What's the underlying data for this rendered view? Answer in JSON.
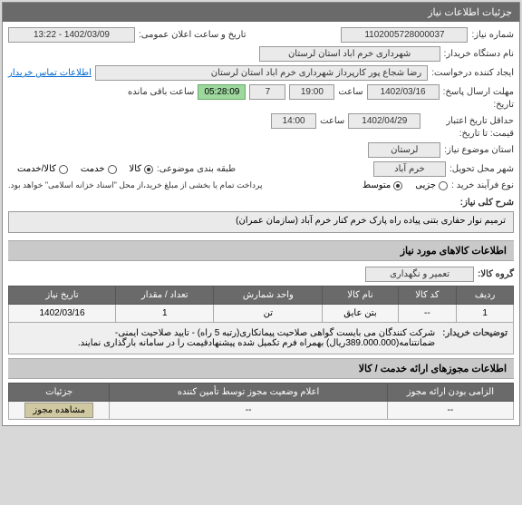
{
  "panel1_title": "جزئیات اطلاعات نیاز",
  "labels": {
    "need_no": "شماره نیاز:",
    "announce_date": "تاریخ و ساعت اعلان عمومی:",
    "buyer_org": "نام دستگاه خریدار:",
    "request_creator": "ایجاد کننده درخواست:",
    "contact": "اطلاعات تماس خریدار",
    "reply_deadline": "مهلت ارسال پاسخ:",
    "hour": "ساعت",
    "remain": "ساعت باقی مانده",
    "date": "تاریخ:",
    "min_credit": "حداقل تاریخ اعتبار",
    "price_until": "قیمت: تا تاریخ:",
    "subject_province": "استان موضوع نیاز:",
    "delivery_city": "شهر محل تحویل:",
    "category": "طبقه بندی موضوعی:",
    "goods": "کالا",
    "service": "خدمت",
    "goods_service": "کالا/خدمت",
    "purchase_type": "نوع فرآیند خرید :",
    "partial": "جزیی",
    "medium": "متوسط",
    "payment_note": "پرداخت تمام یا بخشی از مبلغ خرید،از محل \"اسناد خزانه اسلامی\" خواهد بود.",
    "need_desc_label": "شرح کلی نیاز:",
    "goods_group": "گروه کالا:",
    "buyer_notes_label": "توضیحات خریدار:"
  },
  "values": {
    "need_no": "1102005728000037",
    "announce_date": "1402/03/09 - 13:22",
    "buyer_org": "شهرداری خرم اباد استان لرستان",
    "request_creator": "رضا شجاع پور کارپرداز شهرداری خرم اباد استان لرستان",
    "reply_deadline_date": "1402/03/16",
    "reply_deadline_hour": "19:00",
    "reply_days": "7",
    "remain_time": "05:28:09",
    "credit_date": "1402/04/29",
    "credit_hour": "14:00",
    "province": "لرستان",
    "city": "خرم آباد",
    "need_desc": "ترمیم نوار حفاری بتنی پیاده راه پارک خرم کنار خرم آباد (سازمان عمران)",
    "goods_group": "تعمیر و نگهداری",
    "buyer_notes": "شرکت کنندگان می بایست گواهی صلاحیت پیمانکاری(رتبه 5 راه) - تایید صلاحیت ایمنی- ضمانتنامه(389.000.000ریال) بهمراه فرم تکمیل شده پیشنهادقیمت را در سامانه بارگذاری نمایند."
  },
  "section_titles": {
    "goods_info": "اطلاعات کالاهای مورد نیاز",
    "permits": "اطلاعات مجوزهای ارائه خدمت / کالا"
  },
  "table1": {
    "headers": [
      "ردیف",
      "کد کالا",
      "نام کالا",
      "واحد شمارش",
      "تعداد / مقدار",
      "تاریخ نیاز"
    ],
    "row": {
      "idx": "1",
      "code": "--",
      "name": "بتن عایق",
      "unit": "تن",
      "qty": "1",
      "date": "1402/03/16"
    }
  },
  "table2": {
    "headers": [
      "الزامی بودن ارائه مجوز",
      "اعلام وضعیت مجوز توسط تأمین کننده",
      "جزئیات"
    ],
    "row": {
      "c1": "--",
      "c2": "--",
      "btn": "مشاهده مجوز"
    }
  }
}
